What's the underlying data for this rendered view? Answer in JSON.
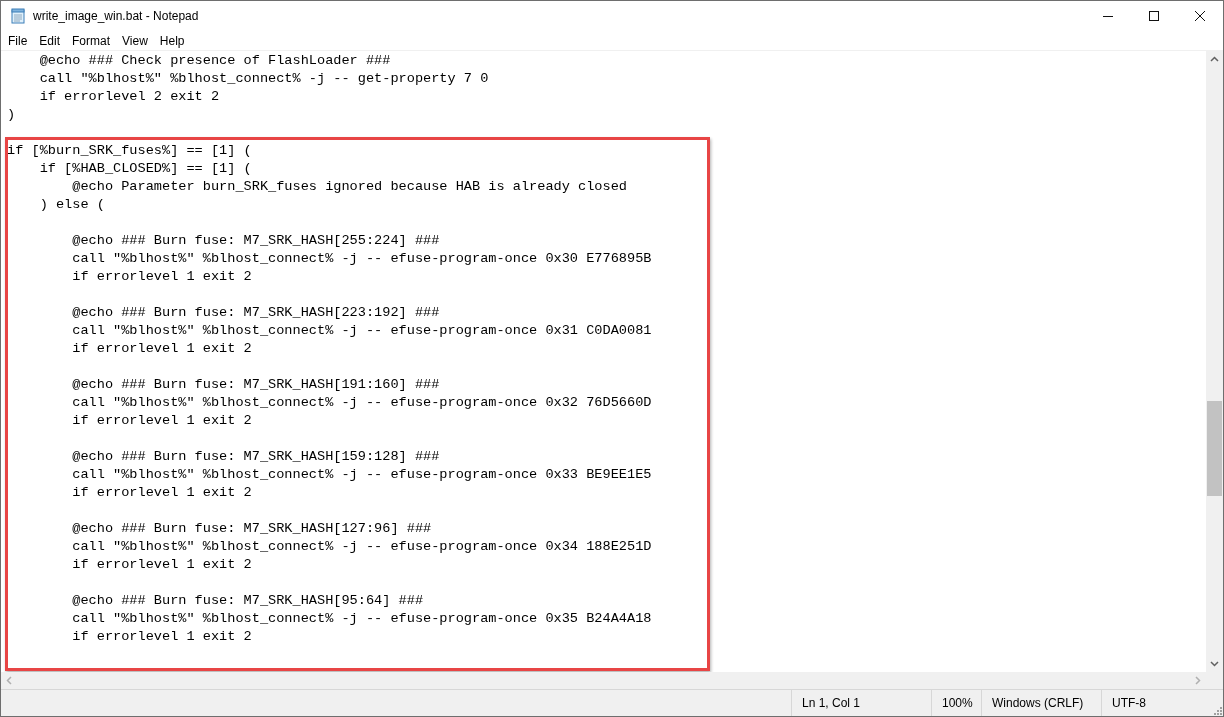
{
  "window": {
    "title": "write_image_win.bat - Notepad"
  },
  "menu": [
    "File",
    "Edit",
    "Format",
    "View",
    "Help"
  ],
  "editor": {
    "blocks": [
      {
        "highlighted": false,
        "paragraphs": [
          [
            "    @echo ### Check presence of FlashLoader ###",
            "    call \"%blhost%\" %blhost_connect% -j -- get-property 7 0",
            "    if errorlevel 2 exit 2",
            ")"
          ]
        ]
      },
      {
        "highlighted": true,
        "paragraphs": [
          [
            "if [%burn_SRK_fuses%] == [1] (",
            "    if [%HAB_CLOSED%] == [1] (",
            "        @echo Parameter burn_SRK_fuses ignored because HAB is already closed",
            "    ) else ("
          ],
          [
            "        @echo ### Burn fuse: M7_SRK_HASH[255:224] ###",
            "        call \"%blhost%\" %blhost_connect% -j -- efuse-program-once 0x30 E776895B",
            "        if errorlevel 1 exit 2"
          ],
          [
            "        @echo ### Burn fuse: M7_SRK_HASH[223:192] ###",
            "        call \"%blhost%\" %blhost_connect% -j -- efuse-program-once 0x31 C0DA0081",
            "        if errorlevel 1 exit 2"
          ],
          [
            "        @echo ### Burn fuse: M7_SRK_HASH[191:160] ###",
            "        call \"%blhost%\" %blhost_connect% -j -- efuse-program-once 0x32 76D5660D",
            "        if errorlevel 1 exit 2"
          ],
          [
            "        @echo ### Burn fuse: M7_SRK_HASH[159:128] ###",
            "        call \"%blhost%\" %blhost_connect% -j -- efuse-program-once 0x33 BE9EE1E5",
            "        if errorlevel 1 exit 2"
          ],
          [
            "        @echo ### Burn fuse: M7_SRK_HASH[127:96] ###",
            "        call \"%blhost%\" %blhost_connect% -j -- efuse-program-once 0x34 188E251D",
            "        if errorlevel 1 exit 2"
          ],
          [
            "        @echo ### Burn fuse: M7_SRK_HASH[95:64] ###",
            "        call \"%blhost%\" %blhost_connect% -j -- efuse-program-once 0x35 B24A4A18",
            "        if errorlevel 1 exit 2"
          ]
        ]
      }
    ]
  },
  "status_bar": {
    "position": "Ln 1, Col 1",
    "zoom": "100%",
    "line_ending": "Windows (CRLF)",
    "encoding": "UTF-8"
  }
}
